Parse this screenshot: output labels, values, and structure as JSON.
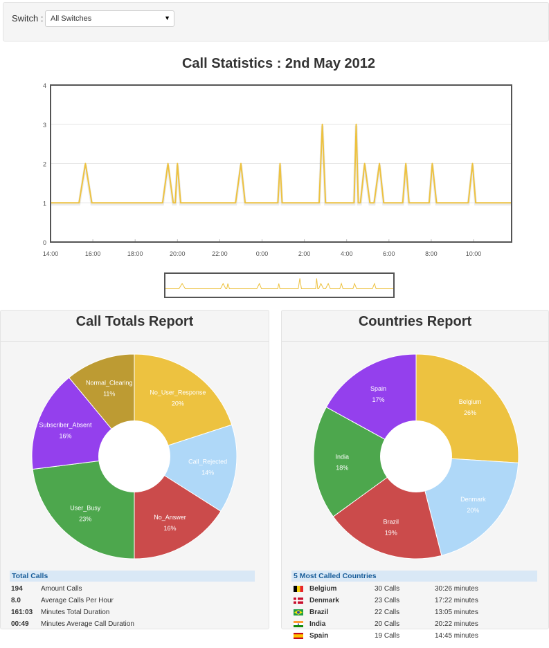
{
  "toolbar": {
    "switch_label": "Switch :",
    "switch_value": "All Switches"
  },
  "chart_title": "Call Statistics : 2nd May 2012",
  "chart_data": [
    {
      "type": "line",
      "title": "Call Statistics : 2nd May 2012",
      "xlabel": "",
      "ylabel": "",
      "ylim": [
        0,
        4
      ],
      "yticks": [
        0,
        1,
        2,
        3,
        4
      ],
      "xlim": [
        14.0,
        35.8
      ],
      "xtick_values": [
        14,
        16,
        18,
        20,
        22,
        24,
        26,
        28,
        30,
        32,
        34
      ],
      "xtick_labels": [
        "14:00",
        "16:00",
        "18:00",
        "20:00",
        "22:00",
        "0:00",
        "2:00",
        "4:00",
        "6:00",
        "8:00",
        "10:00"
      ],
      "grid": true,
      "color": "#edc240",
      "x": [
        14.0,
        15.35,
        15.65,
        15.95,
        19.3,
        19.55,
        19.8,
        19.9,
        20.0,
        20.15,
        22.75,
        23.0,
        23.2,
        24.75,
        24.85,
        24.95,
        26.7,
        26.85,
        27.0,
        28.35,
        28.45,
        28.55,
        28.65,
        28.85,
        29.1,
        29.3,
        29.55,
        29.75,
        29.95,
        30.65,
        30.8,
        30.95,
        31.9,
        32.05,
        32.25,
        33.75,
        33.95,
        34.1,
        35.8
      ],
      "y": [
        1,
        1,
        2,
        1,
        1,
        2,
        1,
        1,
        2,
        1,
        1,
        2,
        1,
        1,
        2,
        1,
        1,
        3,
        1,
        1,
        3,
        1,
        1,
        2,
        1,
        1,
        2,
        1,
        1,
        1,
        2,
        1,
        1,
        2,
        1,
        1,
        2,
        1,
        1
      ]
    },
    {
      "type": "pie",
      "title": "Call Totals Report",
      "slices": [
        {
          "label": "No_User_Response",
          "value": 20,
          "pct_label": "20%",
          "color": "#edc240"
        },
        {
          "label": "Call_Rejected",
          "value": 14,
          "pct_label": "14%",
          "color": "#afd8f8"
        },
        {
          "label": "No_Answer",
          "value": 16,
          "pct_label": "16%",
          "color": "#cb4b4b"
        },
        {
          "label": "User_Busy",
          "value": 23,
          "pct_label": "23%",
          "color": "#4da74d"
        },
        {
          "label": "Subscriber_Absent",
          "value": 16,
          "pct_label": "16%",
          "color": "#9440ed"
        },
        {
          "label": "Normal_Clearing",
          "value": 11,
          "pct_label": "11%",
          "color": "#bd9b33"
        }
      ]
    },
    {
      "type": "pie",
      "title": "Countries Report",
      "slices": [
        {
          "label": "Belgium",
          "value": 26,
          "pct_label": "26%",
          "color": "#edc240"
        },
        {
          "label": "Denmark",
          "value": 20,
          "pct_label": "20%",
          "color": "#afd8f8"
        },
        {
          "label": "Brazil",
          "value": 19,
          "pct_label": "19%",
          "color": "#cb4b4b"
        },
        {
          "label": "India",
          "value": 18,
          "pct_label": "18%",
          "color": "#4da74d"
        },
        {
          "label": "Spain",
          "value": 17,
          "pct_label": "17%",
          "color": "#9440ed"
        }
      ]
    }
  ],
  "call_totals": {
    "title": "Call Totals Report",
    "table_title": "Total Calls",
    "rows": [
      {
        "value": "194",
        "label": "Amount Calls"
      },
      {
        "value": "8.0",
        "label": "Average Calls Per Hour"
      },
      {
        "value": "161:03",
        "label": "Minutes Total Duration"
      },
      {
        "value": "00:49",
        "label": "Minutes Average Call Duration"
      }
    ]
  },
  "countries": {
    "title": "Countries Report",
    "table_title": "5 Most Called Countries",
    "rows": [
      {
        "flag": "belgium-flag-icon",
        "country": "Belgium",
        "calls": "30 Calls",
        "minutes": "30:26 minutes"
      },
      {
        "flag": "denmark-flag-icon",
        "country": "Denmark",
        "calls": "23 Calls",
        "minutes": "17:22 minutes"
      },
      {
        "flag": "brazil-flag-icon",
        "country": "Brazil",
        "calls": "22 Calls",
        "minutes": "13:05 minutes"
      },
      {
        "flag": "india-flag-icon",
        "country": "India",
        "calls": "20 Calls",
        "minutes": "20:22 minutes"
      },
      {
        "flag": "spain-flag-icon",
        "country": "Spain",
        "calls": "19 Calls",
        "minutes": "14:45 minutes"
      }
    ]
  }
}
